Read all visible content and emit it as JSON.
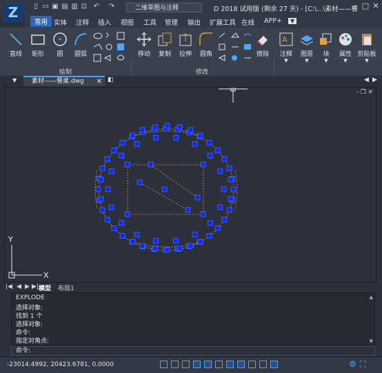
{
  "app": {
    "title": "D 2018 试用版 (剩余 27 天) - [C:\\...\\素材——餐",
    "workspace": "二维草图与注释",
    "logo_letter": "Z"
  },
  "menus": [
    "常用",
    "实体",
    "注释",
    "插入",
    "视图",
    "工具",
    "管理",
    "输出",
    "扩展工具",
    "在线",
    "APP+"
  ],
  "ribbon": {
    "draw_group": "绘制",
    "modify_group": "修改",
    "draw_buttons": [
      "直线",
      "矩形",
      "圆",
      "圆弧"
    ],
    "modify_buttons": [
      "移动",
      "复制",
      "拉伸",
      "圆角",
      "擦除"
    ],
    "panels": [
      "注释",
      "图层",
      "块",
      "属性",
      "剪贴板"
    ]
  },
  "file_tab": "素材——餐桌.dwg",
  "layout_tabs": [
    "模型",
    "布局1"
  ],
  "axis": {
    "y": "Y",
    "x": "X"
  },
  "command_history": [
    "EXPLODE",
    "选择对象:",
    "找到 1 个",
    "选择对象:",
    "命令:",
    "指定对角点:"
  ],
  "command_prompt": "命令:",
  "status": {
    "coords": "-23014.4992, 20423.6781, 0.0000"
  },
  "colors": {
    "accent": "#2f67b3",
    "selection": "#0a2bff",
    "background": "#2b303b"
  }
}
